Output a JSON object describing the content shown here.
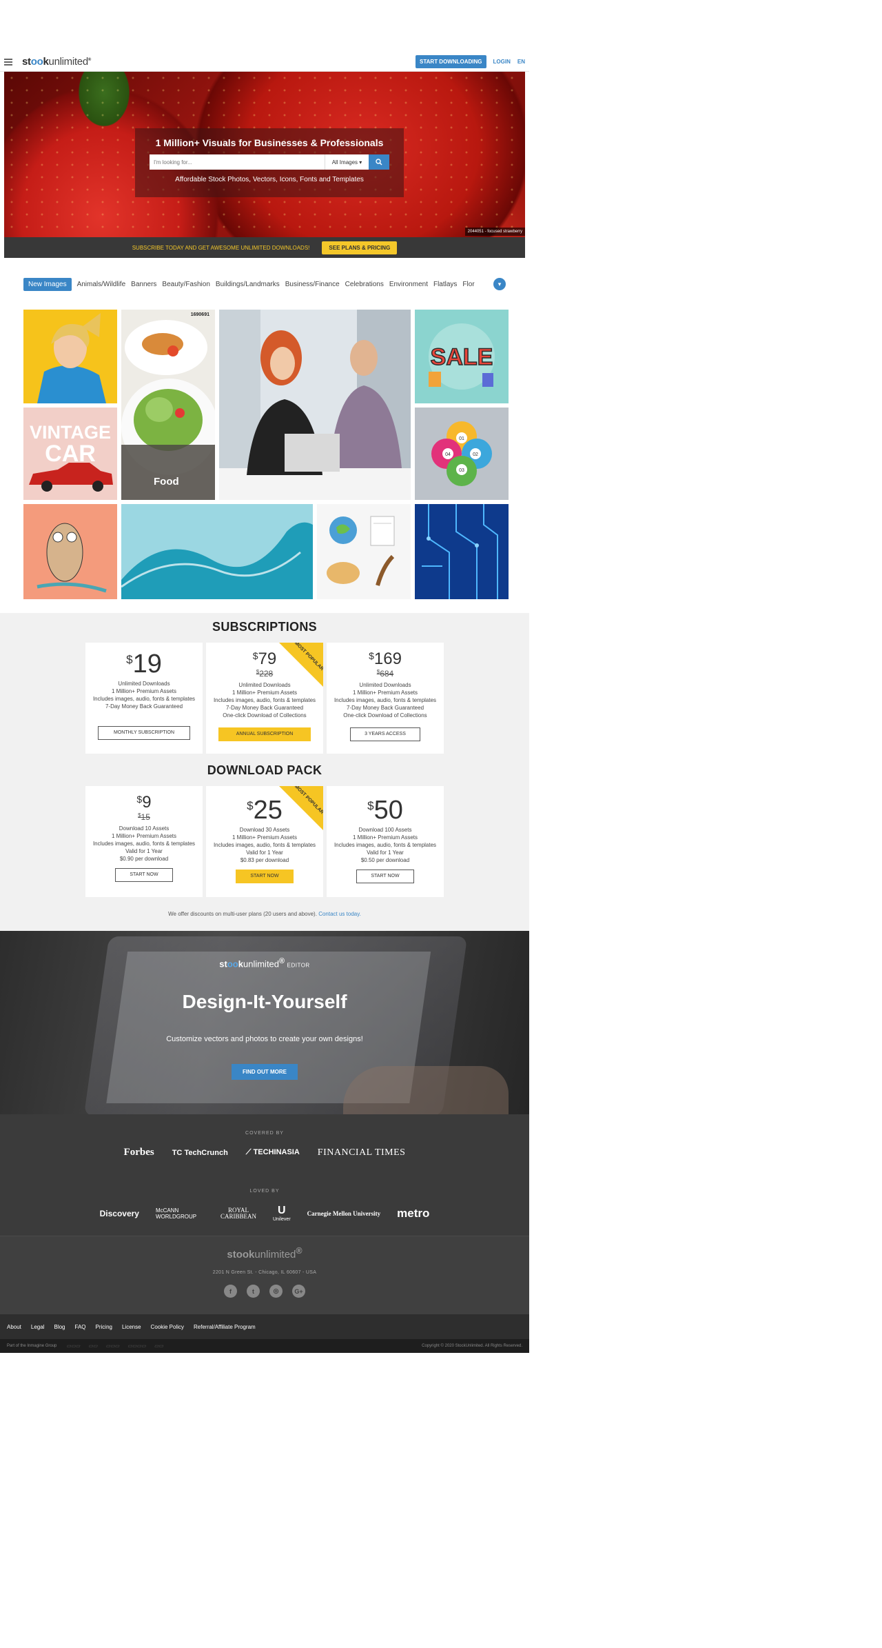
{
  "header": {
    "logo": {
      "part1": "st",
      "part2": "oo",
      "part3": "k",
      "part4": "unlimited",
      "mark": "®"
    },
    "start_label": "START DOWNLOADING",
    "login_label": "LOGIN",
    "lang_label": "EN"
  },
  "hero": {
    "title": "1 Million+ Visuals for Businesses & Professionals",
    "search_placeholder": "I'm looking for...",
    "search_select": "All Images",
    "subtitle": "Affordable Stock Photos, Vectors, Icons, Fonts and Templates",
    "caption": "2044051 - focused strawberry",
    "promo_text": "SUBSCRIBE TODAY AND GET AWESOME UNLIMITED DOWNLOADS!",
    "promo_button": "SEE PLANS & PRICING"
  },
  "categories": [
    "New Images",
    "Animals/Wildlife",
    "Banners",
    "Beauty/Fashion",
    "Buildings/Landmarks",
    "Business/Finance",
    "Celebrations",
    "Environment",
    "Flatlays",
    "Flor"
  ],
  "gallery": {
    "food_label": "Food",
    "food_id": "1690691",
    "vintage_line1": "VINTAGE",
    "vintage_line2": "CAR",
    "sale_text": "SALE",
    "info_steps": [
      "01",
      "02",
      "03",
      "04"
    ]
  },
  "subscriptions": {
    "title": "SUBSCRIPTIONS",
    "ribbon": "MOST POPULAR",
    "plans": [
      {
        "currency": "$",
        "price": "19",
        "old_price": "",
        "features": [
          "Unlimited Downloads",
          "1 Million+ Premium Assets",
          "Includes images, audio, fonts & templates",
          "7-Day Money Back Guaranteed"
        ],
        "button": "MONTHLY SUBSCRIPTION"
      },
      {
        "currency": "$",
        "price": "79",
        "old_price": "228",
        "features": [
          "Unlimited Downloads",
          "1 Million+ Premium Assets",
          "Includes images, audio, fonts & templates",
          "7-Day Money Back Guaranteed",
          "One-click Download of Collections"
        ],
        "button": "ANNUAL SUBSCRIPTION"
      },
      {
        "currency": "$",
        "price": "169",
        "old_price": "684",
        "features": [
          "Unlimited Downloads",
          "1 Million+ Premium Assets",
          "Includes images, audio, fonts & templates",
          "7-Day Money Back Guaranteed",
          "One-click Download of Collections"
        ],
        "button": "3 YEARS ACCESS"
      }
    ]
  },
  "download_pack": {
    "title": "DOWNLOAD PACK",
    "plans": [
      {
        "currency": "$",
        "price": "9",
        "old_price": "15",
        "features": [
          "Download 10 Assets",
          "1 Million+ Premium Assets",
          "Includes images, audio, fonts & templates",
          "Valid for 1 Year",
          "$0.90 per download"
        ],
        "button": "START NOW"
      },
      {
        "currency": "$",
        "price": "25",
        "old_price": "",
        "features": [
          "Download 30 Assets",
          "1 Million+ Premium Assets",
          "Includes images, audio, fonts & templates",
          "Valid for 1 Year",
          "$0.83 per download"
        ],
        "button": "START NOW"
      },
      {
        "currency": "$",
        "price": "50",
        "old_price": "",
        "features": [
          "Download 100 Assets",
          "1 Million+ Premium Assets",
          "Includes images, audio, fonts & templates",
          "Valid for 1 Year",
          "$0.50 per download"
        ],
        "button": "START NOW"
      }
    ],
    "discount_text": "We offer discounts on multi-user plans (20 users and above).",
    "contact_link": "Contact us today."
  },
  "editor": {
    "tag": "EDITOR",
    "title": "Design-It-Yourself",
    "subtitle": "Customize vectors and photos to create your own designs!",
    "button": "FIND OUT MORE"
  },
  "covered": {
    "label": "COVERED BY",
    "brands": [
      "Forbes",
      "TechCrunch",
      "TECHINASIA",
      "FINANCIAL TIMES"
    ]
  },
  "loved": {
    "label": "LOVED BY",
    "brands": {
      "discovery": "Discovery",
      "mccann": "McCANN WORLDGROUP",
      "royal1": "ROYAL",
      "royal2": "CARIBBEAN",
      "unilever": "Unilever",
      "cmu": "Carnegie Mellon University",
      "metro": "metro"
    }
  },
  "footer": {
    "address": "2201 N Green St. - Chicago, IL 60607 - USA",
    "links": [
      "About",
      "Legal",
      "Blog",
      "FAQ",
      "Pricing",
      "License",
      "Cookie Policy",
      "Referral/Affiliate Program"
    ],
    "part_of": "Part of the Inmagine Group",
    "copyright": "Copyright © 2020 StockUnlimited. All Rights Reserved."
  },
  "colors": {
    "accent": "#3a86c6",
    "promo": "#f4c72a",
    "button_yellow": "#f6c523"
  },
  "icons": [
    "hamburger-icon",
    "search-icon",
    "chevron-down-icon",
    "facebook-icon",
    "twitter-icon",
    "instagram-icon",
    "google-plus-icon"
  ]
}
